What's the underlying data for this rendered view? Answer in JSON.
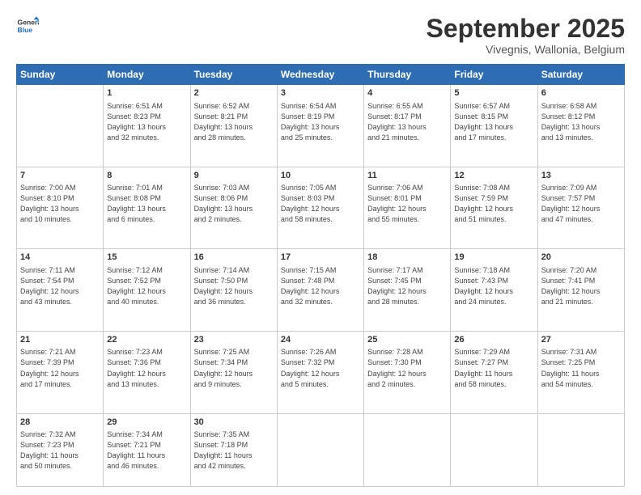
{
  "logo": {
    "line1": "General",
    "line2": "Blue"
  },
  "title": "September 2025",
  "subtitle": "Vivegnis, Wallonia, Belgium",
  "days_header": [
    "Sunday",
    "Monday",
    "Tuesday",
    "Wednesday",
    "Thursday",
    "Friday",
    "Saturday"
  ],
  "weeks": [
    [
      {
        "day": "",
        "info": ""
      },
      {
        "day": "1",
        "info": "Sunrise: 6:51 AM\nSunset: 8:23 PM\nDaylight: 13 hours\nand 32 minutes."
      },
      {
        "day": "2",
        "info": "Sunrise: 6:52 AM\nSunset: 8:21 PM\nDaylight: 13 hours\nand 28 minutes."
      },
      {
        "day": "3",
        "info": "Sunrise: 6:54 AM\nSunset: 8:19 PM\nDaylight: 13 hours\nand 25 minutes."
      },
      {
        "day": "4",
        "info": "Sunrise: 6:55 AM\nSunset: 8:17 PM\nDaylight: 13 hours\nand 21 minutes."
      },
      {
        "day": "5",
        "info": "Sunrise: 6:57 AM\nSunset: 8:15 PM\nDaylight: 13 hours\nand 17 minutes."
      },
      {
        "day": "6",
        "info": "Sunrise: 6:58 AM\nSunset: 8:12 PM\nDaylight: 13 hours\nand 13 minutes."
      }
    ],
    [
      {
        "day": "7",
        "info": "Sunrise: 7:00 AM\nSunset: 8:10 PM\nDaylight: 13 hours\nand 10 minutes."
      },
      {
        "day": "8",
        "info": "Sunrise: 7:01 AM\nSunset: 8:08 PM\nDaylight: 13 hours\nand 6 minutes."
      },
      {
        "day": "9",
        "info": "Sunrise: 7:03 AM\nSunset: 8:06 PM\nDaylight: 13 hours\nand 2 minutes."
      },
      {
        "day": "10",
        "info": "Sunrise: 7:05 AM\nSunset: 8:03 PM\nDaylight: 12 hours\nand 58 minutes."
      },
      {
        "day": "11",
        "info": "Sunrise: 7:06 AM\nSunset: 8:01 PM\nDaylight: 12 hours\nand 55 minutes."
      },
      {
        "day": "12",
        "info": "Sunrise: 7:08 AM\nSunset: 7:59 PM\nDaylight: 12 hours\nand 51 minutes."
      },
      {
        "day": "13",
        "info": "Sunrise: 7:09 AM\nSunset: 7:57 PM\nDaylight: 12 hours\nand 47 minutes."
      }
    ],
    [
      {
        "day": "14",
        "info": "Sunrise: 7:11 AM\nSunset: 7:54 PM\nDaylight: 12 hours\nand 43 minutes."
      },
      {
        "day": "15",
        "info": "Sunrise: 7:12 AM\nSunset: 7:52 PM\nDaylight: 12 hours\nand 40 minutes."
      },
      {
        "day": "16",
        "info": "Sunrise: 7:14 AM\nSunset: 7:50 PM\nDaylight: 12 hours\nand 36 minutes."
      },
      {
        "day": "17",
        "info": "Sunrise: 7:15 AM\nSunset: 7:48 PM\nDaylight: 12 hours\nand 32 minutes."
      },
      {
        "day": "18",
        "info": "Sunrise: 7:17 AM\nSunset: 7:45 PM\nDaylight: 12 hours\nand 28 minutes."
      },
      {
        "day": "19",
        "info": "Sunrise: 7:18 AM\nSunset: 7:43 PM\nDaylight: 12 hours\nand 24 minutes."
      },
      {
        "day": "20",
        "info": "Sunrise: 7:20 AM\nSunset: 7:41 PM\nDaylight: 12 hours\nand 21 minutes."
      }
    ],
    [
      {
        "day": "21",
        "info": "Sunrise: 7:21 AM\nSunset: 7:39 PM\nDaylight: 12 hours\nand 17 minutes."
      },
      {
        "day": "22",
        "info": "Sunrise: 7:23 AM\nSunset: 7:36 PM\nDaylight: 12 hours\nand 13 minutes."
      },
      {
        "day": "23",
        "info": "Sunrise: 7:25 AM\nSunset: 7:34 PM\nDaylight: 12 hours\nand 9 minutes."
      },
      {
        "day": "24",
        "info": "Sunrise: 7:26 AM\nSunset: 7:32 PM\nDaylight: 12 hours\nand 5 minutes."
      },
      {
        "day": "25",
        "info": "Sunrise: 7:28 AM\nSunset: 7:30 PM\nDaylight: 12 hours\nand 2 minutes."
      },
      {
        "day": "26",
        "info": "Sunrise: 7:29 AM\nSunset: 7:27 PM\nDaylight: 11 hours\nand 58 minutes."
      },
      {
        "day": "27",
        "info": "Sunrise: 7:31 AM\nSunset: 7:25 PM\nDaylight: 11 hours\nand 54 minutes."
      }
    ],
    [
      {
        "day": "28",
        "info": "Sunrise: 7:32 AM\nSunset: 7:23 PM\nDaylight: 11 hours\nand 50 minutes."
      },
      {
        "day": "29",
        "info": "Sunrise: 7:34 AM\nSunset: 7:21 PM\nDaylight: 11 hours\nand 46 minutes."
      },
      {
        "day": "30",
        "info": "Sunrise: 7:35 AM\nSunset: 7:18 PM\nDaylight: 11 hours\nand 42 minutes."
      },
      {
        "day": "",
        "info": ""
      },
      {
        "day": "",
        "info": ""
      },
      {
        "day": "",
        "info": ""
      },
      {
        "day": "",
        "info": ""
      }
    ]
  ]
}
